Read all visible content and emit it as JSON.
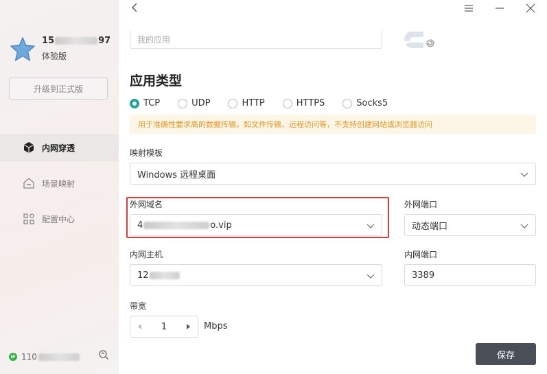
{
  "sidebar": {
    "user": {
      "id_prefix": "15",
      "id_suffix": "97",
      "plan": "体验版"
    },
    "upgrade_label": "升级到正式版",
    "nav": [
      {
        "label": "内网穿透",
        "icon": "cube-icon",
        "active": true
      },
      {
        "label": "场景映射",
        "icon": "home-icon",
        "active": false
      },
      {
        "label": "配置中心",
        "icon": "grid-icon",
        "active": false
      }
    ],
    "footer": {
      "badge": "IP",
      "ip_prefix": "110"
    }
  },
  "main": {
    "app_input_placeholder": "我的应用",
    "section_title": "应用类型",
    "protocols": [
      {
        "label": "TCP",
        "checked": true
      },
      {
        "label": "UDP",
        "checked": false
      },
      {
        "label": "HTTP",
        "checked": false
      },
      {
        "label": "HTTPS",
        "checked": false
      },
      {
        "label": "Socks5",
        "checked": false
      }
    ],
    "notice": "用于准确性要求高的数据传输，如文件传输、远程访问等，不支持创建网站或浏览器访问",
    "template": {
      "label": "映射模板",
      "value": "Windows 远程桌面"
    },
    "ext_domain": {
      "label": "外网域名",
      "value_prefix": "4",
      "value_suffix": "o.vip"
    },
    "ext_port": {
      "label": "外网端口",
      "value": "动态端口"
    },
    "int_host": {
      "label": "内网主机",
      "value_prefix": "12"
    },
    "int_port": {
      "label": "内网端口",
      "value": "3389"
    },
    "bandwidth": {
      "label": "带宽",
      "value": "1",
      "unit": "Mbps"
    },
    "save_label": "保存"
  },
  "colors": {
    "accent": "#1fa39a",
    "warning_text": "#e69526",
    "highlight": "#e53935",
    "save_button": "#4a4f57"
  }
}
